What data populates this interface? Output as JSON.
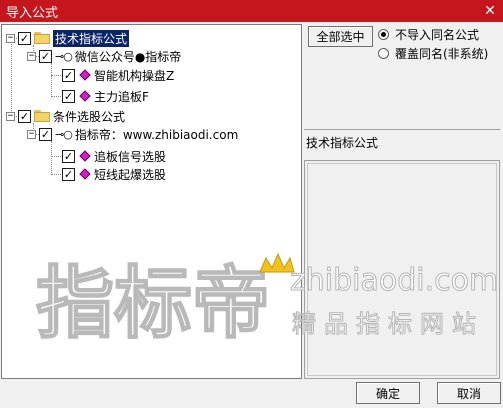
{
  "window": {
    "title": "导入公式",
    "close_glyph": "✕"
  },
  "tree": {
    "expander_collapsed": "−",
    "check_glyph": "✓",
    "groups": [
      {
        "label": "技术指标公式",
        "selected": true,
        "authors": [
          {
            "label": "微信公众号●指标帝",
            "items": [
              "智能机构操盘Z",
              "主力追板F"
            ]
          }
        ]
      },
      {
        "label": "条件选股公式",
        "selected": false,
        "authors": [
          {
            "label": "指标帝：www.zhibiaodi.com",
            "items": [
              "追板信号选股",
              "短线起爆选股"
            ]
          }
        ]
      }
    ]
  },
  "options": {
    "select_all_label": "全部选中",
    "radio_options": [
      {
        "label": "不导入同名公式",
        "checked": true
      },
      {
        "label": "覆盖同名(非系统)",
        "checked": false
      }
    ]
  },
  "info": {
    "header": "技术指标公式"
  },
  "watermark": {
    "logo_text": "指标帝",
    "domain": "zhibiaodi.com",
    "slogan": "精品指标网站",
    "colors": {
      "logo_fill": "#ffffff",
      "logo_stroke": "#b4b4b4",
      "crown": "#f3c21b"
    }
  },
  "footer": {
    "ok_label": "确定",
    "cancel_label": "取消"
  },
  "colors": {
    "titlebar": "#c4161c",
    "selection": "#0a246a",
    "diamond": "#d41cc8",
    "folder": "#f4d36b"
  }
}
